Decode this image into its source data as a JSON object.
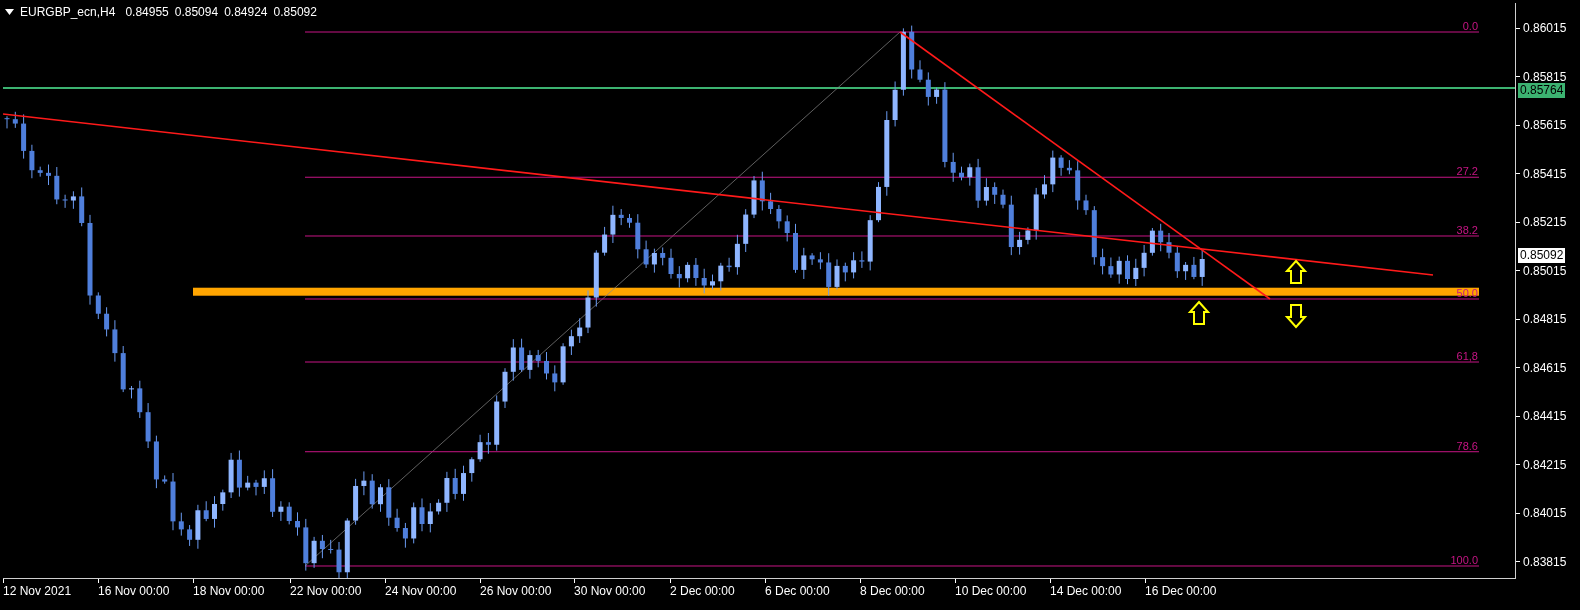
{
  "symbol": {
    "label": "EURGBP_ecn,H4",
    "ohlc": [
      "0.84955",
      "0.85094",
      "0.84924",
      "0.85092"
    ]
  },
  "fibonacci_levels": [
    {
      "label": "0.0"
    },
    {
      "label": "27.2"
    },
    {
      "label": "38.2"
    },
    {
      "label": "50.0"
    },
    {
      "label": "61,8"
    },
    {
      "label": "78.6"
    },
    {
      "label": "100.0"
    }
  ],
  "price_axis": {
    "ticks": [
      "0.86015",
      "0.85815",
      "0.85615",
      "0.85415",
      "0.85215",
      "0.85015",
      "0.84815",
      "0.84615",
      "0.84415",
      "0.84215",
      "0.84015",
      "0.83815"
    ],
    "line_marker": "0.85764",
    "current_price": "0.85092"
  },
  "time_axis": [
    "12 Nov 2021",
    "16 Nov 00:00",
    "18 Nov 00:00",
    "22 Nov 00:00",
    "24 Nov 00:00",
    "26 Nov 00:00",
    "30 Nov 00:00",
    "2 Dec 00:00",
    "6 Dec 00:00",
    "8 Dec 00:00",
    "10 Dec 00:00",
    "14 Dec 00:00",
    "16 Dec 00:00"
  ]
}
